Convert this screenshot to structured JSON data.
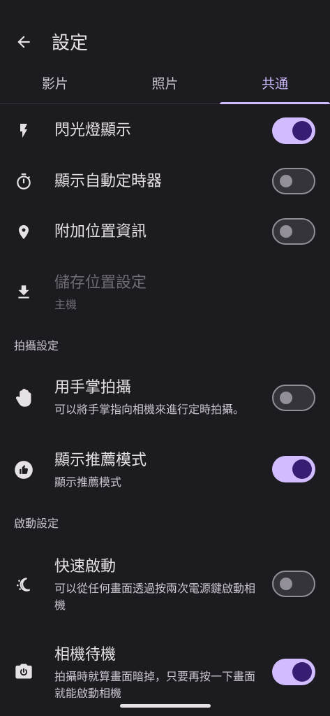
{
  "header": {
    "title": "設定",
    "back_icon": "arrow-back-icon"
  },
  "tabs": [
    {
      "label": "影片",
      "active": false
    },
    {
      "label": "照片",
      "active": false
    },
    {
      "label": "共通",
      "active": true
    }
  ],
  "settings": {
    "flash": {
      "title": "閃光燈顯示",
      "icon": "flash-icon",
      "toggle": "on"
    },
    "timer": {
      "title": "顯示自動定時器",
      "icon": "timer-icon",
      "toggle": "off"
    },
    "location": {
      "title": "附加位置資訊",
      "icon": "location-pin-icon",
      "toggle": "off"
    },
    "storage": {
      "title": "儲存位置設定",
      "subtitle": "主機",
      "icon": "download-icon",
      "enabled": false
    }
  },
  "sections": {
    "capture": {
      "label": "拍攝設定"
    },
    "launch": {
      "label": "啟動設定"
    }
  },
  "capture_settings": {
    "palm": {
      "title": "用手掌拍攝",
      "subtitle": "可以將手掌指向相機來進行定時拍攝。",
      "icon": "palm-icon",
      "toggle": "off"
    },
    "suggest": {
      "title": "顯示推薦模式",
      "subtitle": "顯示推薦模式",
      "icon": "thumbs-up-icon",
      "toggle": "on"
    }
  },
  "launch_settings": {
    "quick": {
      "title": "快速啟動",
      "subtitle": "可以從任何畫面透過按兩次電源鍵啟動相機",
      "icon": "quick-launch-icon",
      "toggle": "off"
    },
    "standby": {
      "title": "相機待機",
      "subtitle": "拍攝時就算畫面暗掉，只要再按一下畫面就能啟動相機",
      "icon": "camera-power-icon",
      "toggle": "on"
    }
  },
  "colors": {
    "background": "#1c1b1f",
    "accent": "#d0bcff",
    "switch_thumb_on": "#381e72"
  }
}
